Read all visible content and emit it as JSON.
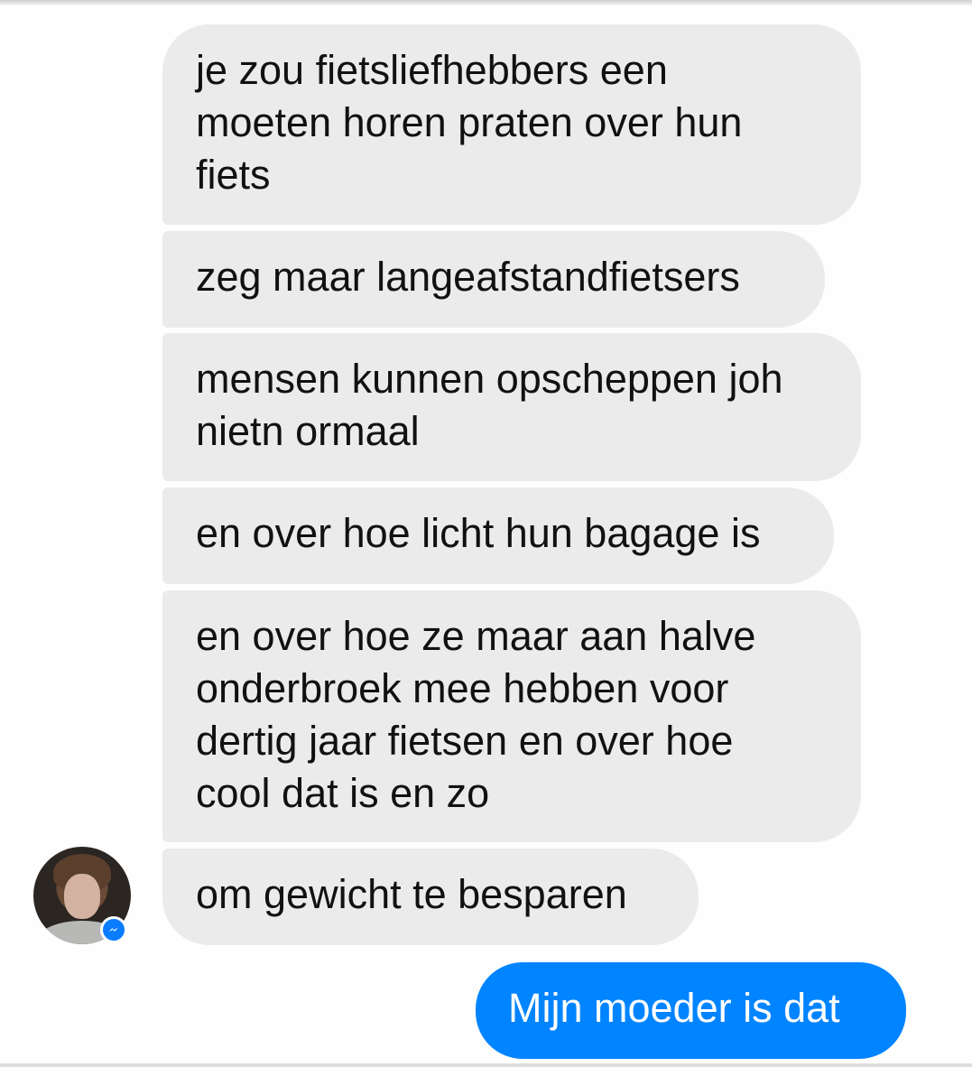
{
  "conversation": {
    "received": [
      "je zou fietsliefhebbers een\nmoeten horen praten over hun\nfiets",
      "zeg maar langeafstandfietsers",
      "mensen kunnen opscheppen joh\nnietn ormaal",
      "en over hoe licht hun bagage is",
      "en over hoe ze maar aan halve\nonderbroek mee hebben voor\ndertig jaar fietsen en over hoe\ncool dat is en zo",
      "om gewicht te besparen"
    ],
    "sent": [
      "Mijn moeder is dat"
    ]
  },
  "sender": {
    "avatar_icon": "profile-photo",
    "badge_icon": "messenger-icon"
  },
  "colors": {
    "received_bubble": "#ebebeb",
    "sent_bubble": "#0084ff",
    "background": "#fefefe"
  }
}
